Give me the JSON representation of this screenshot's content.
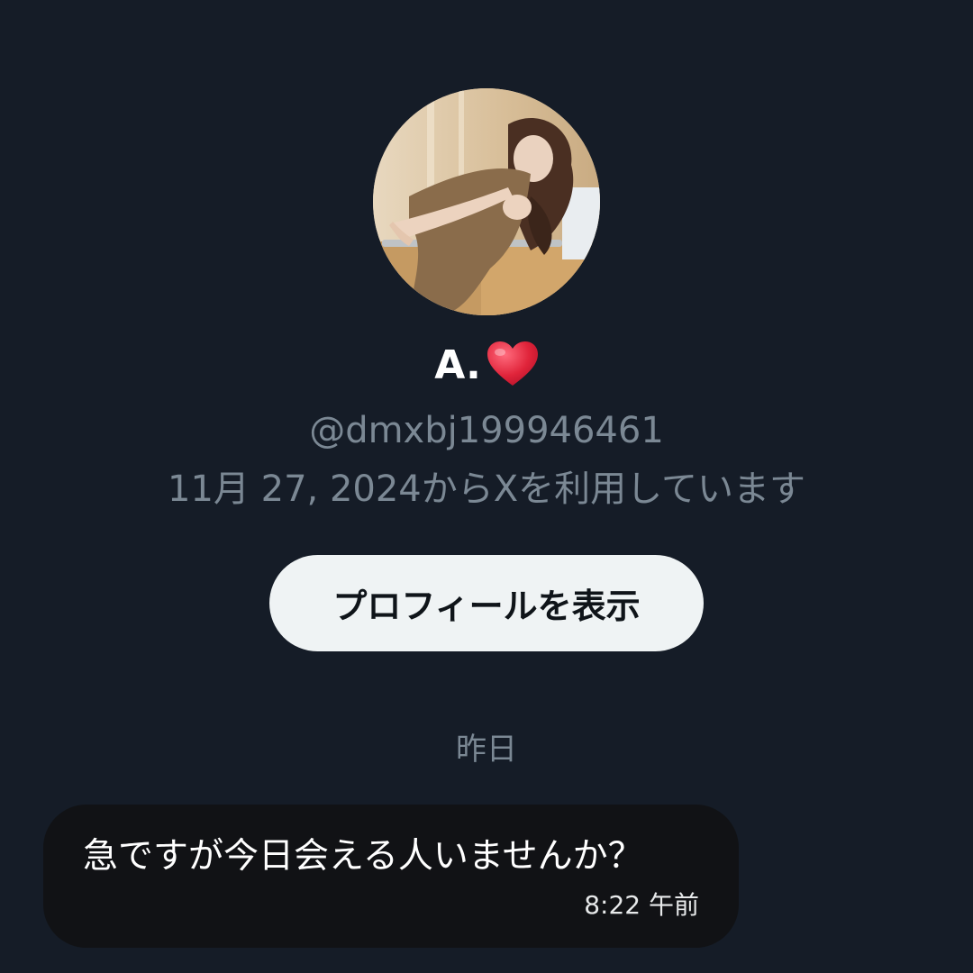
{
  "profile": {
    "display_name": "A.",
    "name_emoji": "heart-emoji",
    "handle": "@dmxbj199946461",
    "joined": "11月 27, 2024からXを利用しています",
    "view_profile_label": "プロフィールを表示"
  },
  "conversation": {
    "date_separator": "昨日",
    "messages": [
      {
        "text": "急ですが今日会える人いませんか？",
        "time": "8:22 午前"
      }
    ]
  },
  "colors": {
    "background": "#151c27",
    "button_bg": "#eff3f4",
    "secondary_text": "#7b8894",
    "bubble_bg": "#111215",
    "heart": "#e0243a"
  }
}
